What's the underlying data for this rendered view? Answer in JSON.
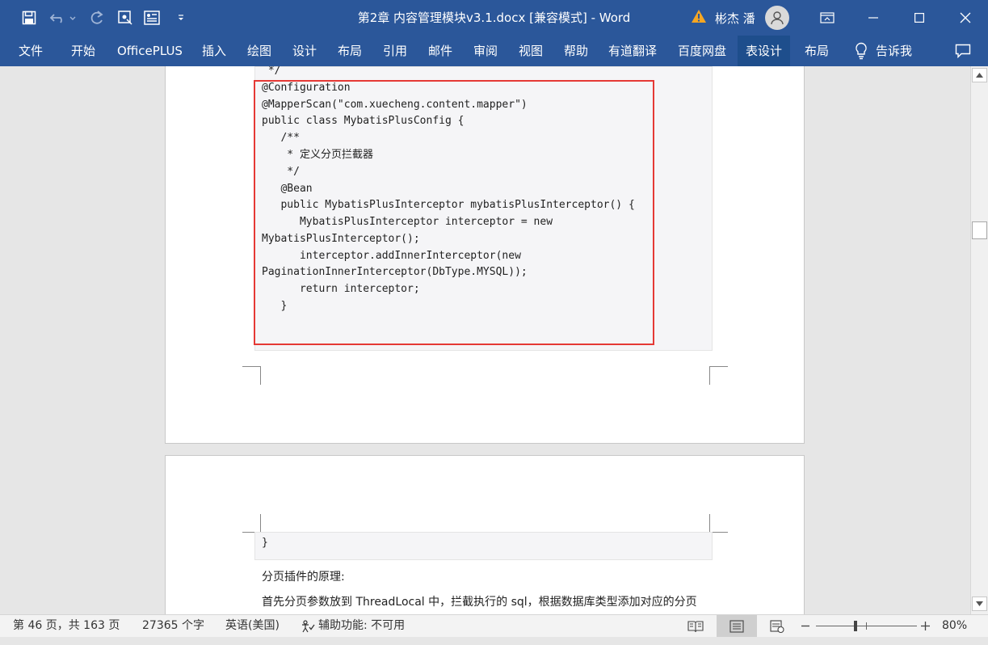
{
  "titlebar": {
    "doc_title": "第2章 内容管理模块v3.1.docx [兼容模式]  -  Word",
    "user_name": "彬杰 潘",
    "qat": [
      "save-icon",
      "undo-icon",
      "redo-icon",
      "touch-mode-icon",
      "form-icon",
      "customize-qat-icon"
    ]
  },
  "ribbon": {
    "tabs": [
      "文件",
      "开始",
      "OfficePLUS",
      "插入",
      "绘图",
      "设计",
      "布局",
      "引用",
      "邮件",
      "审阅",
      "视图",
      "帮助",
      "有道翻译",
      "百度网盘",
      "表设计",
      "布局"
    ],
    "active_tab": "表设计",
    "tell_me": "告诉我"
  },
  "document": {
    "page1_code": [
      " */",
      "@Configuration",
      "@MapperScan(\"com.xuecheng.content.mapper\")",
      "public class MybatisPlusConfig {",
      "   /**",
      "    * 定义分页拦截器",
      "    */",
      "   @Bean",
      "   public MybatisPlusInterceptor mybatisPlusInterceptor() {",
      "      MybatisPlusInterceptor interceptor = new",
      "MybatisPlusInterceptor();",
      "      interceptor.addInnerInterceptor(new",
      "PaginationInnerInterceptor(DbType.MYSQL));",
      "      return interceptor;",
      "   }"
    ],
    "page2_code": [
      "}"
    ],
    "paragraph1": "分页插件的原理:",
    "paragraph2": "首先分页参数放到 ThreadLocal 中，拦截执行的 sql，根据数据库类型添加对应的分页"
  },
  "statusbar": {
    "page_info": "第 46 页，共 163 页",
    "word_count": "27365 个字",
    "language": "英语(美国)",
    "accessibility": "辅助功能: 不可用",
    "zoom_label": "80%",
    "zoom_percent": 80
  },
  "colors": {
    "title_bg": "#2b579a",
    "highlight": "#e53935"
  }
}
